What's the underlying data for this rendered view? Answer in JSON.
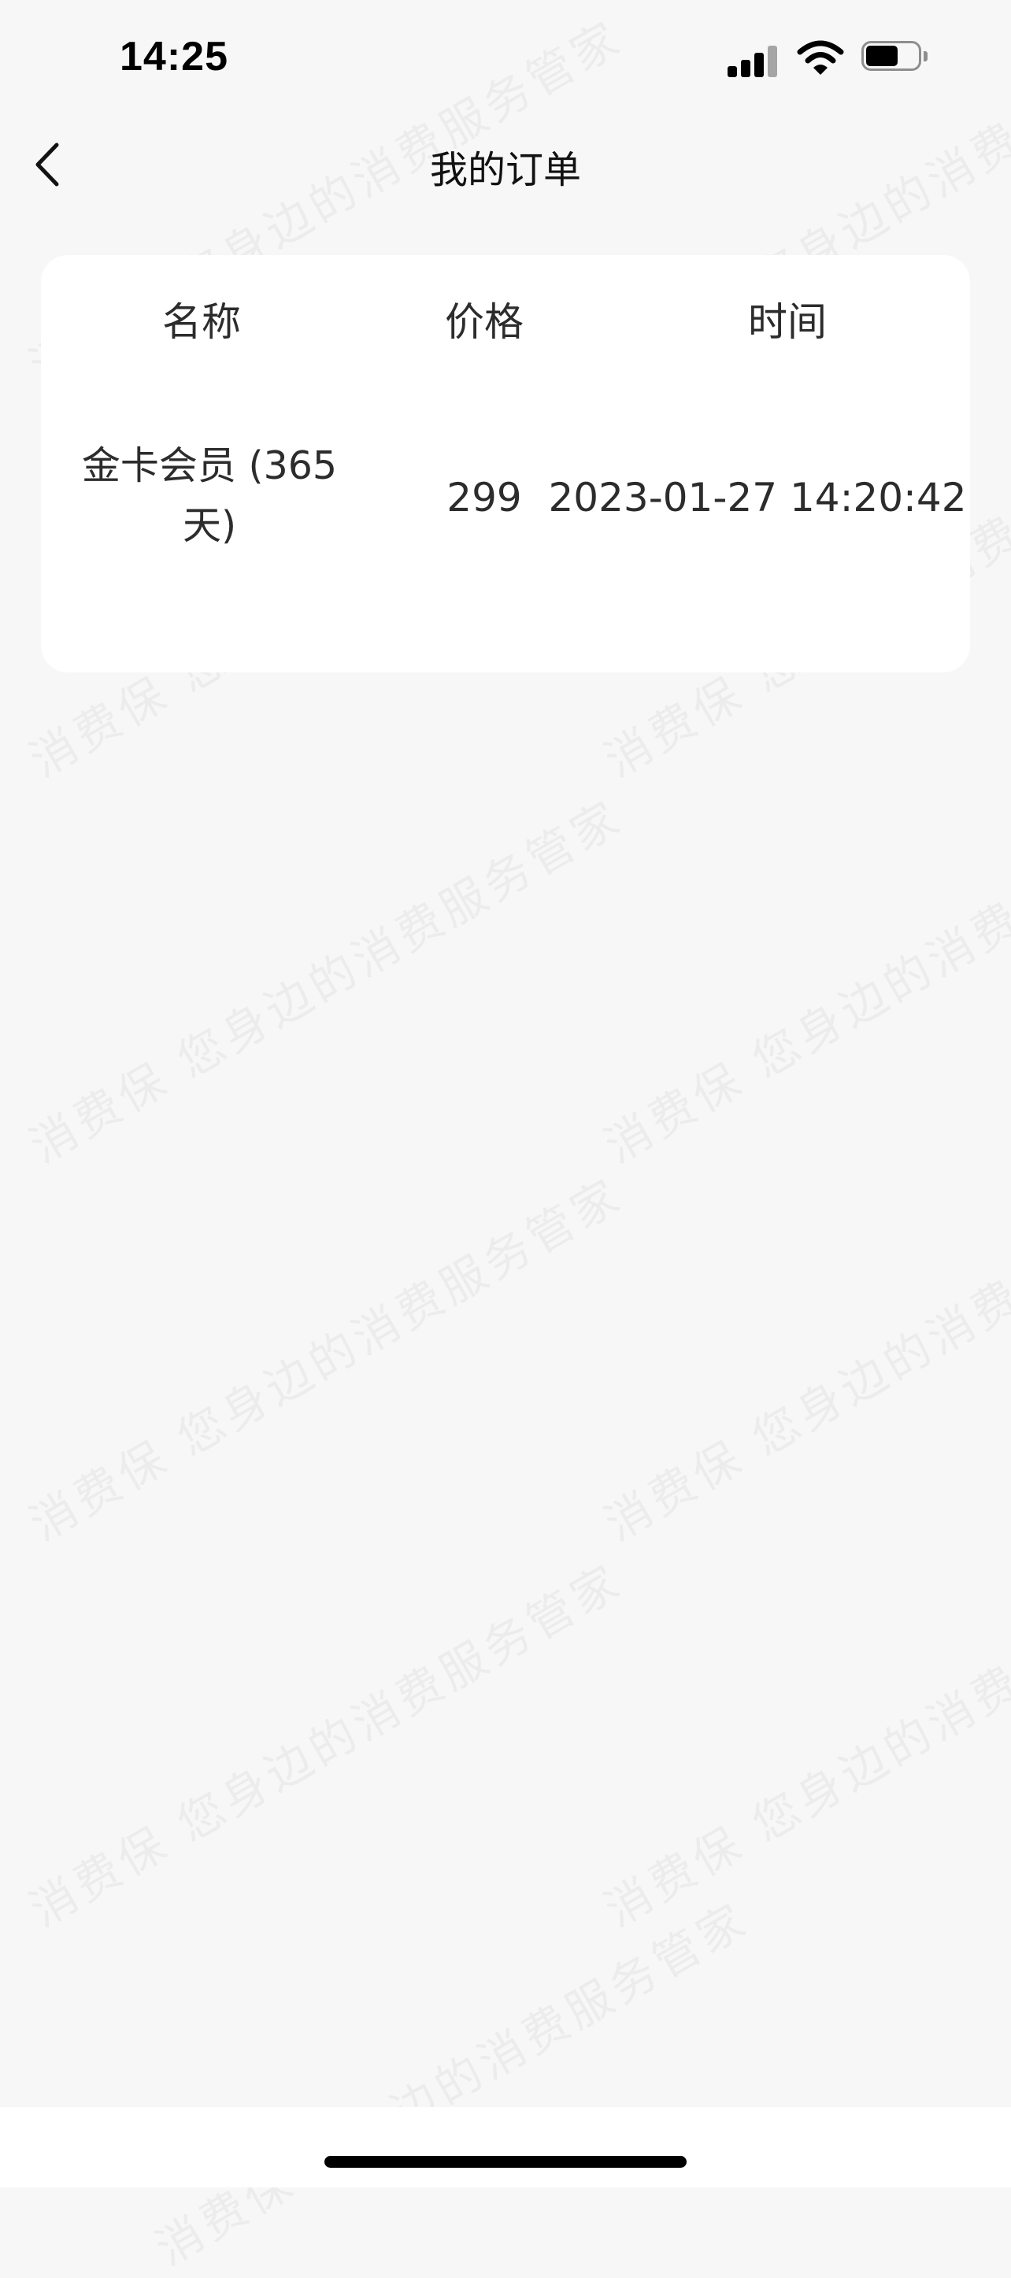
{
  "status_bar": {
    "time": "14:25"
  },
  "nav": {
    "title": "我的订单",
    "back_icon": "chevron-left-icon"
  },
  "table": {
    "headers": [
      "名称",
      "价格",
      "时间"
    ],
    "rows": [
      {
        "name_line1": "金卡会员 (365",
        "name_line2": "天)",
        "price": "299",
        "time": "2023-01-27 14:20:42"
      }
    ]
  },
  "watermark": {
    "text": "消费保 您身边的消费服务管家"
  },
  "colors": {
    "background": "#f7f7f7",
    "card": "#ffffff",
    "text": "#2c2c2c"
  }
}
